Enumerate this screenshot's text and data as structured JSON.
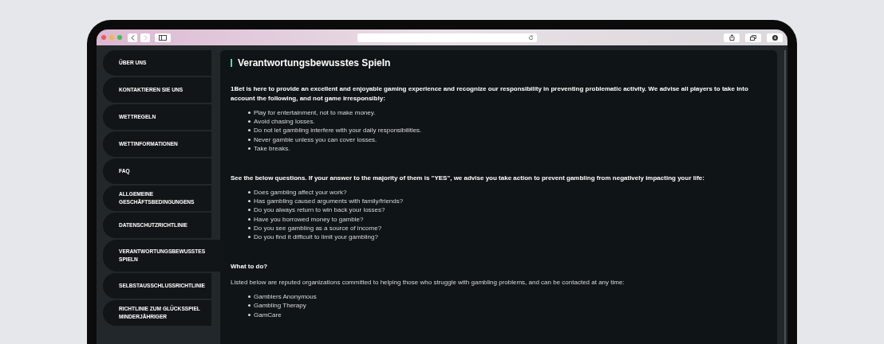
{
  "sidebar": {
    "items": [
      {
        "label": "ÜBER UNS",
        "selected": false
      },
      {
        "label": "KONTAKTIEREN SIE UNS",
        "selected": false
      },
      {
        "label": "WETTREGELN",
        "selected": false
      },
      {
        "label": "WETTINFORMATIONEN",
        "selected": false
      },
      {
        "label": "FAQ",
        "selected": false
      },
      {
        "label": "ALLGEMEINE GESCHÄFTSBEDINGUNGENS",
        "selected": false
      },
      {
        "label": "DATENSCHUTZRICHTLINIE",
        "selected": false
      },
      {
        "label": "VERANTWORTUNGSBEWUSSTES SPIELN",
        "selected": true
      },
      {
        "label": "SELBSTAUSSCHLUSSRICHTLINIE",
        "selected": false
      },
      {
        "label": "RICHTLINIE ZUM GLÜCKSSPIEL MINDERJÄHRIGER",
        "selected": false
      }
    ]
  },
  "content": {
    "title": "Verantwortungsbewusstes Spieln",
    "blocks": [
      {
        "kind": "bold",
        "text": "1Bet is here to provide an excellent and enjoyable gaming experience and recognize our responsibility in preventing problematic activity. We advise all players to take into account the following, and not game irresponsibly:"
      },
      {
        "kind": "bullets",
        "items": [
          "Play for entertainment, not to make money.",
          "Avoid chasing losses.",
          "Do not let gambling interfere with your daily responsibilities.",
          "Never gamble unless you can cover losses.",
          "Take breaks."
        ]
      },
      {
        "kind": "bold",
        "text": "See the below questions. If your answer to the majority of them is \"YES\", we advise you take action to prevent gambling from negatively impacting your life:"
      },
      {
        "kind": "bullets",
        "items": [
          "Does gambling affect your work?",
          "Has gambling caused arguments with family/friends?",
          "Do you always return to win back your losses?",
          "Have you borrowed money to gamble?",
          "Do you see gambling as a source of income?",
          "Do you find it difficult to limit your gambling?"
        ]
      },
      {
        "kind": "bold",
        "text": "What to do?"
      },
      {
        "kind": "text",
        "text": "Listed below are reputed organizations committed to helping those who struggle with gambling problems, and can be contacted at any time:"
      },
      {
        "kind": "bullets",
        "items": [
          "Gamblers Anonymous",
          "Gambling Therapy",
          "GamCare"
        ]
      }
    ]
  }
}
